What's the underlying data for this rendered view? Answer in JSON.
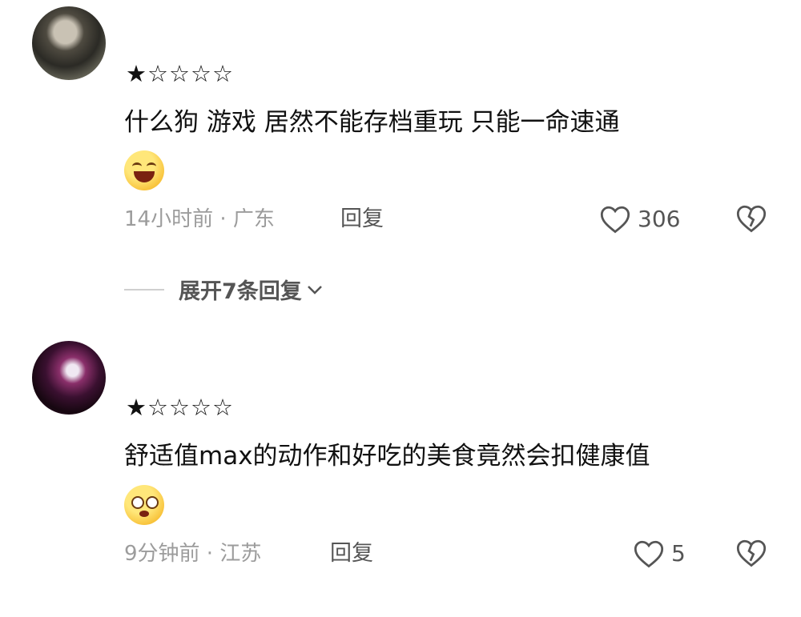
{
  "comments": [
    {
      "rating_filled": "★",
      "rating_empty": "☆☆☆☆",
      "text": "什么狗  游戏 居然不能存档重玩 只能一命速通",
      "emoji": "grinning-sweat-emoji",
      "time_location": "14小时前 · 广东",
      "reply_label": "回复",
      "likes": "306"
    },
    {
      "rating_filled": "★",
      "rating_empty": "☆☆☆☆",
      "text": "舒适值max的动作和好吃的美食竟然会扣健康值",
      "emoji": "flushed-face-emoji",
      "time_location": "9分钟前 · 江苏",
      "reply_label": "回复",
      "likes": "5"
    }
  ],
  "expand_replies": "展开7条回复"
}
